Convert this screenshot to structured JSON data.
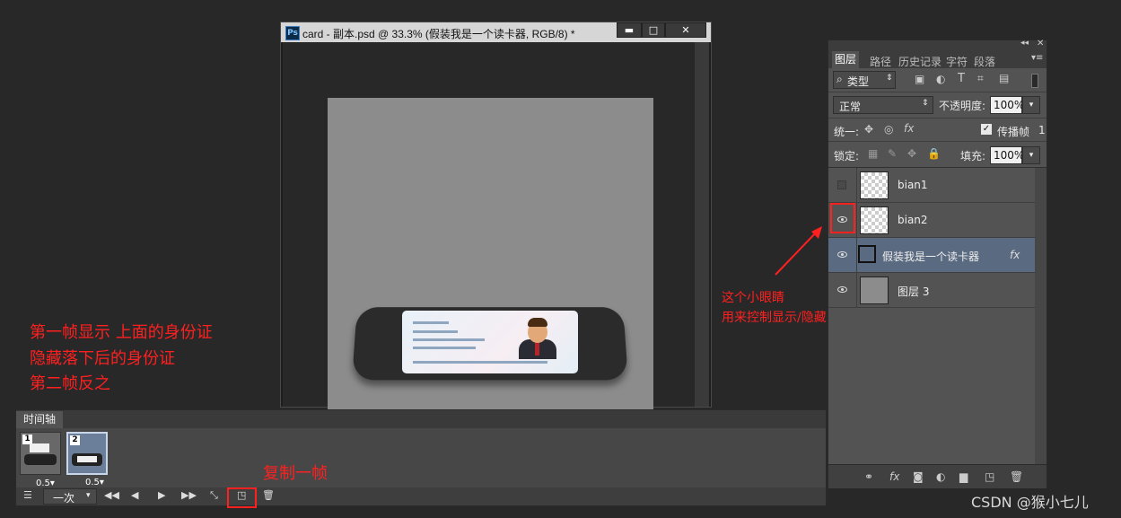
{
  "document": {
    "app_icon": "Ps",
    "title": "card - 副本.psd @ 33.3% (假装我是一个读卡器, RGB/8) *",
    "min_label": "▬",
    "max_label": "□",
    "close_label": "✕"
  },
  "layers_panel": {
    "tabs": [
      "图层",
      "路径",
      "历史记录",
      "字符",
      "段落"
    ],
    "filter_label": "类型",
    "blend_mode": "正常",
    "opacity_label": "不透明度:",
    "opacity_value": "100%",
    "unify_label": "统一:",
    "propagate_label": "传播帧",
    "propagate_value": "1",
    "lock_label": "锁定:",
    "fill_label": "填充:",
    "fill_value": "100%",
    "layers": [
      {
        "name": "bian1",
        "visible": false
      },
      {
        "name": "bian2",
        "visible": true
      },
      {
        "name": "假装我是一个读卡器",
        "visible": true,
        "fx": "fx",
        "selected": true
      },
      {
        "name": "图层 3",
        "visible": true
      }
    ]
  },
  "timeline": {
    "tab_label": "时间轴",
    "frames": [
      {
        "number": "1",
        "delay": "0.5▾"
      },
      {
        "number": "2",
        "delay": "0.5▾"
      }
    ],
    "loop_label": "一次"
  },
  "annotations": {
    "frames_note_1": "第一帧显示 上面的身份证",
    "frames_note_2": "隐藏落下后的身份证",
    "frames_note_3": "第二帧反之",
    "eye_note_1": "这个小眼睛",
    "eye_note_2": "用来控制显示/隐藏",
    "duplicate_note": "复制一帧",
    "accent_color": "#ff2020"
  },
  "watermark": "CSDN @猴小七儿"
}
